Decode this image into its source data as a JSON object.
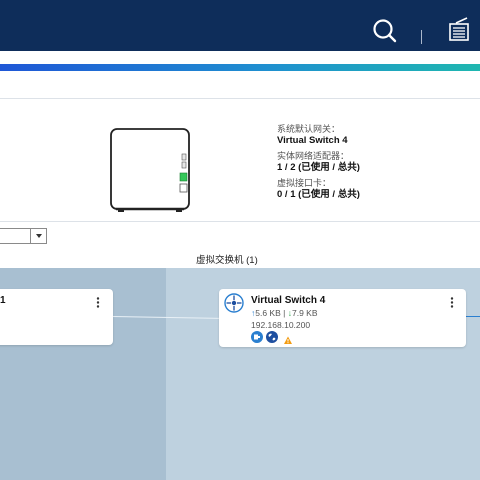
{
  "header": {
    "search_icon": "search-icon",
    "notes_icon": "notes-icon"
  },
  "device_info": {
    "default_gateway_label": "系统默认网关：",
    "default_gateway_value": "Virtual Switch 4",
    "physical_adapter_label": "实体网络适配器：",
    "physical_adapter_value": "1 / 2 (已使用 / 总共)",
    "virtual_adapter_label": "虚拟接口卡：",
    "virtual_adapter_value": "0 / 1 (已使用 / 总共)"
  },
  "filter": {
    "selected": ""
  },
  "section": {
    "title": "虚拟交换机 (1)"
  },
  "cards": {
    "left": {
      "name": "1"
    },
    "right": {
      "name": "Virtual Switch 4",
      "upload": "5.6 KB",
      "download": "7.9 KB",
      "ip": "192.168.10.200"
    }
  },
  "colors": {
    "topbar": "#0e2d5a",
    "accent_blue": "#2a7fd0",
    "status_green": "#34c759",
    "warning_orange": "#f39c12"
  }
}
